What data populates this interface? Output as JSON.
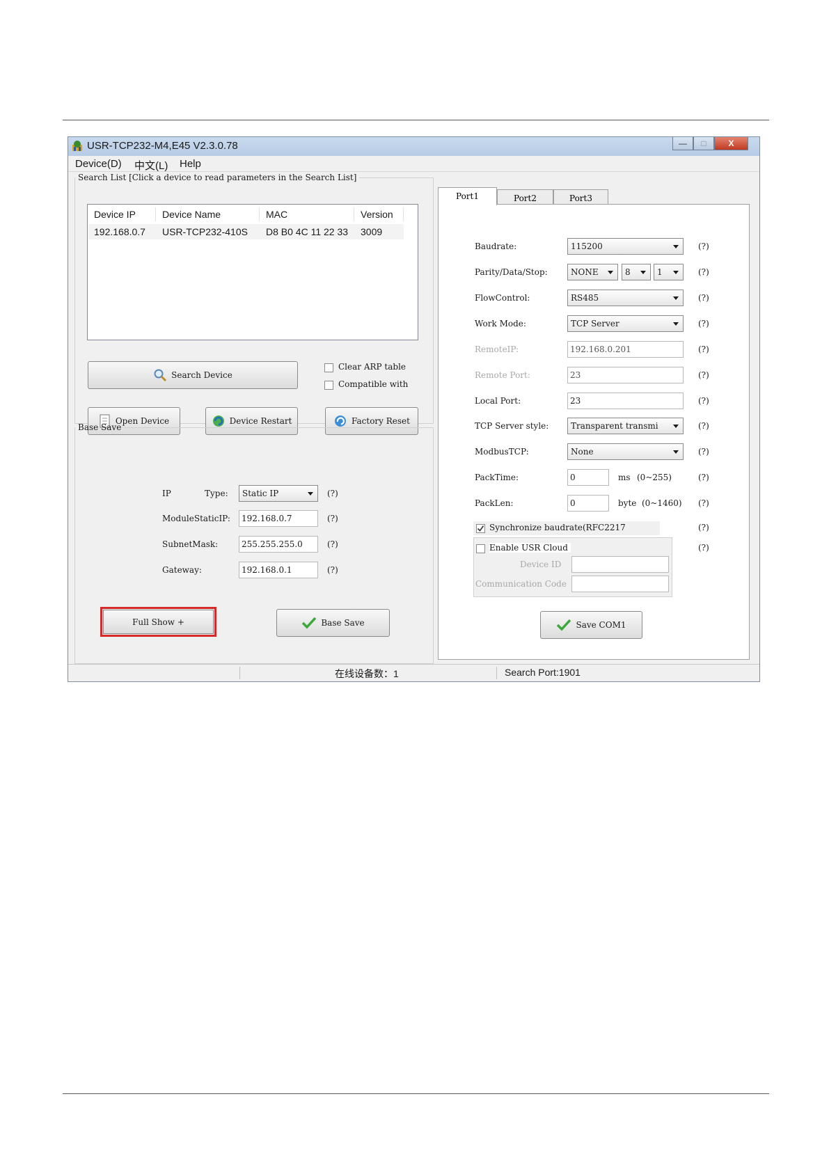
{
  "window": {
    "title": "USR-TCP232-M4,E45 V2.3.0.78",
    "minimize_glyph": "—",
    "maximize_glyph": "□",
    "close_glyph": "X"
  },
  "menu": [
    "Device(D)",
    "中文(L)",
    "Help"
  ],
  "search": {
    "legend": "Search List [Click a device to read parameters in the Search List]",
    "columns": [
      "Device IP",
      "Device Name",
      "MAC",
      "Version"
    ],
    "rows": [
      [
        "192.168.0.7",
        "USR-TCP232-410S",
        "D8 B0 4C 11 22 33",
        "3009"
      ]
    ],
    "search_button": "Search Device",
    "clear_arp": "Clear ARP table",
    "compatible": "Compatible with",
    "open_button": "Open Device",
    "restart_button": "Device Restart",
    "reset_button": "Factory Reset"
  },
  "base": {
    "legend": "Base Save",
    "ip_label": "IP",
    "type_label": "Type:",
    "type_value": "Static IP",
    "static_ip_label": "ModuleStaticIP:",
    "static_ip_value": "192.168.0.7",
    "subnet_label": "SubnetMask:",
    "subnet_value": "255.255.255.0",
    "gateway_label": "Gateway:",
    "gateway_value": "192.168.0.1",
    "help": "(?)",
    "full_show_button": "Full Show  +",
    "base_save_button": "Base Save"
  },
  "tabs": [
    "Port1",
    "Port2",
    "Port3"
  ],
  "port": {
    "baudrate_label": "Baudrate:",
    "baudrate_value": "115200",
    "parity_label": "Parity/Data/Stop:",
    "parity_value": "NONE",
    "data_value": "8",
    "stop_value": "1",
    "flow_label": "FlowControl:",
    "flow_value": "RS485",
    "work_label": "Work Mode:",
    "work_value": "TCP Server",
    "remote_ip_label": "RemoteIP:",
    "remote_ip_value": "192.168.0.201",
    "remote_port_label": "Remote Port:",
    "remote_port_value": "23",
    "local_port_label": "Local Port:",
    "local_port_value": "23",
    "server_style_label": "TCP Server style:",
    "server_style_value": "Transparent transmi",
    "modbus_label": "ModbusTCP:",
    "modbus_value": "None",
    "packtime_label": "PackTime:",
    "packtime_value": "0",
    "packtime_unit": "ms",
    "packtime_range": "(0~255)",
    "packlen_label": "PackLen:",
    "packlen_value": "0",
    "packlen_unit": "byte",
    "packlen_range": "(0~1460)",
    "sync_label": "Synchronize baudrate(RFC2217",
    "cloud_label": "Enable USR Cloud",
    "device_id_label": "Device ID",
    "comm_code_label": "Communication Code",
    "help": "(?)",
    "save_button": "Save COM1"
  },
  "status": {
    "online": "在线设备数：1",
    "port": "Search Port:1901"
  },
  "colors": {
    "highlight": "#d42a2a",
    "check_green": "#3aa83a"
  }
}
